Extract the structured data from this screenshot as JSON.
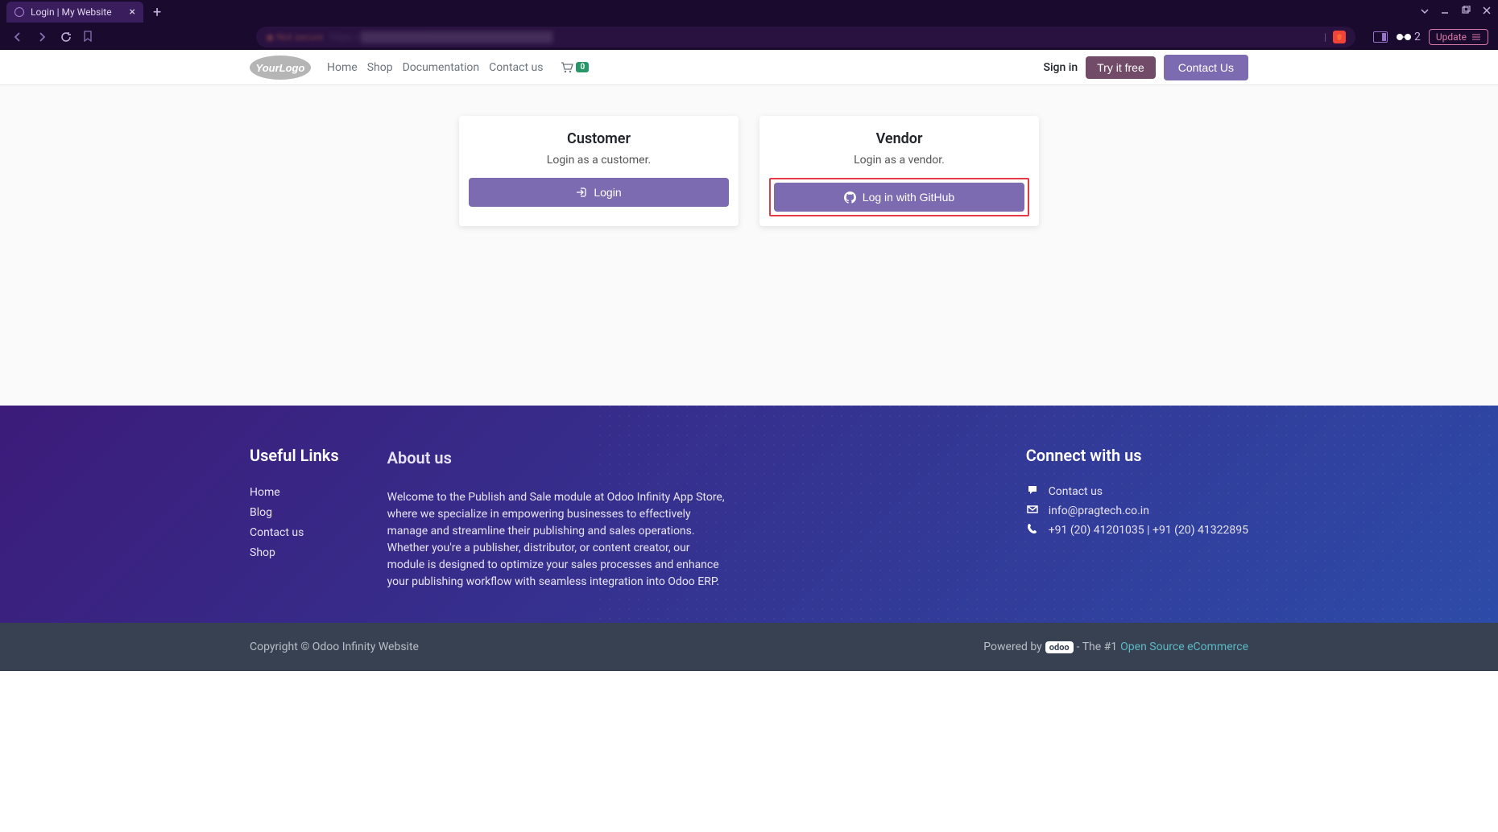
{
  "browser": {
    "tab_title": "Login | My Website",
    "glasses_count": "2",
    "update_label": "Update"
  },
  "header": {
    "nav": [
      "Home",
      "Shop",
      "Documentation",
      "Contact us"
    ],
    "cart_count": "0",
    "signin": "Sign in",
    "try_free": "Try it free",
    "contact_us": "Contact Us"
  },
  "cards": {
    "customer": {
      "title": "Customer",
      "sub": "Login as a customer.",
      "btn": "Login"
    },
    "vendor": {
      "title": "Vendor",
      "sub": "Login as a vendor.",
      "btn": "Log in with GitHub"
    }
  },
  "footer": {
    "useful_links": {
      "title": "Useful Links",
      "items": [
        "Home",
        "Blog",
        "Contact us",
        "Shop"
      ]
    },
    "about": {
      "title": "About us",
      "text": "Welcome to the Publish and Sale module at Odoo Infinity App Store, where we specialize in empowering businesses to effectively manage and streamline their publishing and sales operations. Whether you're a publisher, distributor, or content creator, our module is designed to optimize your sales processes and enhance your publishing workflow with seamless integration into Odoo ERP."
    },
    "connect": {
      "title": "Connect with us",
      "contact": "Contact us",
      "email": "info@pragtech.co.in",
      "phone": "+91 (20) 41201035 | +91 (20) 41322895"
    }
  },
  "bottom": {
    "copyright": "Copyright © Odoo Infinity Website",
    "powered_by": "Powered by",
    "odoo": "odoo",
    "the1": "- The #1",
    "ecommerce_link": "Open Source eCommerce"
  }
}
